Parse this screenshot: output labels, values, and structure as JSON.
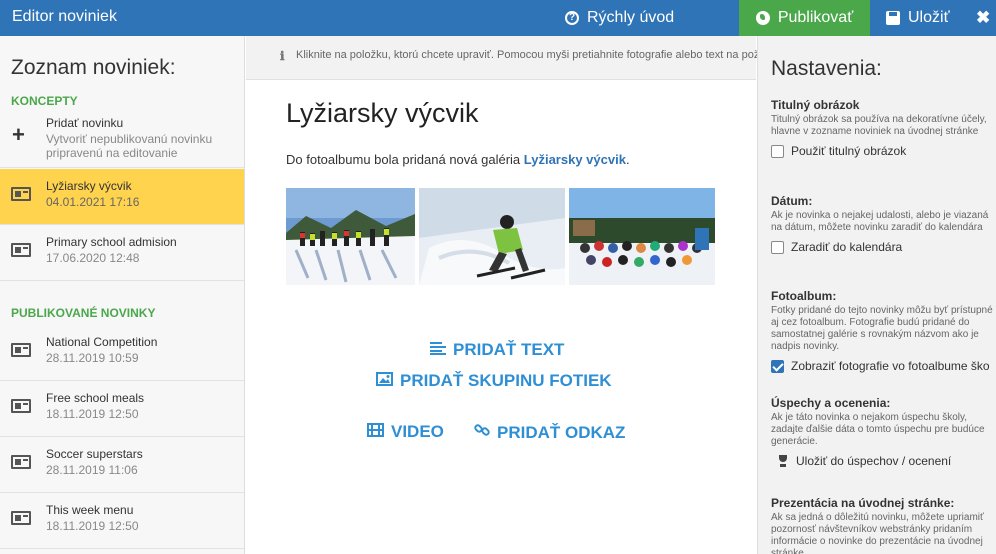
{
  "header": {
    "title": "Editor noviniek",
    "quickstart_label": "Rýchly úvod",
    "publish_label": "Publikovať",
    "save_label": "Uložiť",
    "close_symbol": "✖"
  },
  "sidebar": {
    "title": "Zoznam noviniek:",
    "drafts_heading": "KONCEPTY",
    "add": {
      "title": "Pridať novinku",
      "subtitle": "Vytvoriť nepublikovanú novinku pripravenú na editovanie"
    },
    "drafts": [
      {
        "title": "Lyžiarsky výcvik",
        "date": "04.01.2021 17:16",
        "selected": true
      },
      {
        "title": "Primary school admision",
        "date": "17.06.2020 12:48",
        "selected": false
      }
    ],
    "published_heading": "PUBLIKOVANÉ NOVINKY",
    "published": [
      {
        "title": "National Competition",
        "date": "28.11.2019 10:59"
      },
      {
        "title": "Free school meals",
        "date": "18.11.2019 12:50"
      },
      {
        "title": "Soccer superstars",
        "date": "28.11.2019 11:06"
      },
      {
        "title": "This week menu",
        "date": "18.11.2019 12:50"
      }
    ]
  },
  "infobar": {
    "icon": "info-icon",
    "text": "Kliknite na položku, ktorú chcete upraviť. Pomocou myši pretiahnite fotografie alebo text na požadované miesto."
  },
  "article": {
    "title": "Lyžiarsky výcvik",
    "text_prefix": "Do fotoalbumu bola pridaná nová galéria ",
    "text_link": "Lyžiarsky výcvik",
    "text_suffix": "."
  },
  "actions": {
    "add_text": "PRIDAŤ TEXT",
    "add_photos": "PRIDAŤ SKUPINU FOTIEK",
    "video": "VIDEO",
    "add_link": "PRIDAŤ ODKAZ"
  },
  "settings": {
    "title": "Nastavenia:",
    "cover": {
      "label": "Titulný obrázok",
      "desc": "Titulný obrázok sa používa na dekoratívne účely, hlavne v zozname noviniek na úvodnej stránke",
      "check_label": "Použiť titulný obrázok",
      "checked": false
    },
    "date": {
      "label": "Dátum:",
      "desc": "Ak je novinka o nejakej udalosti, alebo je viazaná na dátum, môžete novinku zaradiť do kalendára",
      "check_label": "Zaradiť do kalendára",
      "checked": false
    },
    "album": {
      "label": "Fotoalbum:",
      "desc": "Fotky pridané do tejto novinky môžu byť prístupné aj cez fotoalbum. Fotografie budú pridané do samostatnej galérie s rovnakým názvom ako je nadpis novinky.",
      "check_label": "Zobraziť fotografie vo fotoalbume ško",
      "checked": true
    },
    "achievements": {
      "label": "Úspechy a ocenenia:",
      "desc": "Ak je táto novinka o nejakom úspechu školy, zadajte ďalšie dáta o tomto úspechu pre budúce generácie.",
      "action_label": "Uložiť do úspechov / ocenení"
    },
    "homepage": {
      "label": "Prezentácia na úvodnej stránke:",
      "desc": "Ak sa jedná o dôležitú novinku, môžete upriamiť pozornosť návštevníkov webstránky pridaním informácie o novinke do prezentácie na úvodnej stránke"
    }
  },
  "colors": {
    "topbar": "#2f74b6",
    "publish": "#4aa84b",
    "selected_item": "#ffd34d",
    "action_blue": "#2f8fd4",
    "section_green": "#4aa84b"
  }
}
